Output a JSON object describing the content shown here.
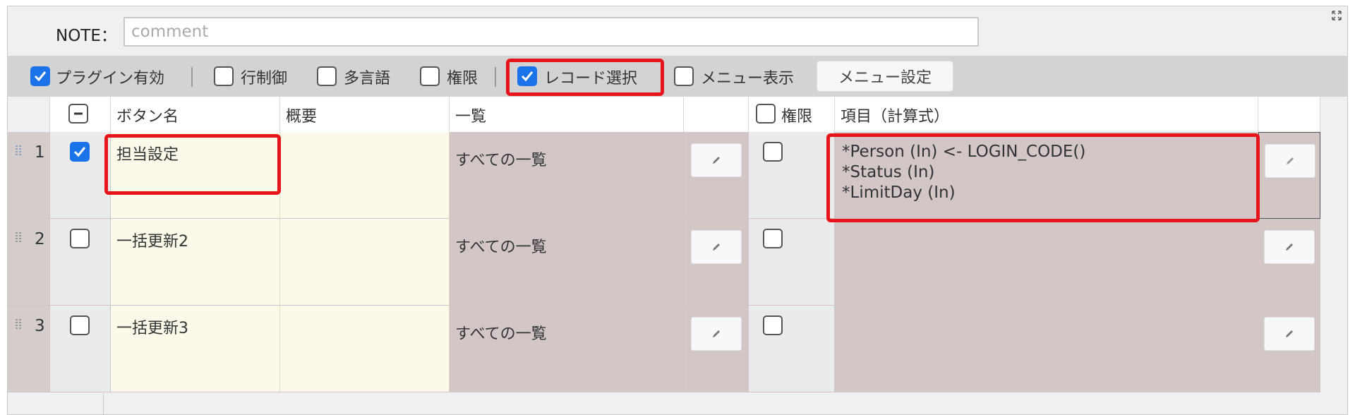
{
  "note": {
    "label": "NOTE：",
    "placeholder": "comment",
    "value": ""
  },
  "toolbar": {
    "options": [
      {
        "label": "プラグイン有効",
        "checked": true
      },
      {
        "label": "行制御",
        "checked": false
      },
      {
        "label": "多言語",
        "checked": false
      },
      {
        "label": "権限",
        "checked": false
      },
      {
        "label": "レコード選択",
        "checked": true
      },
      {
        "label": "メニュー表示",
        "checked": false
      }
    ],
    "menu_button": "メニュー設定"
  },
  "grid": {
    "headers": {
      "button_name": "ボタン名",
      "summary": "概要",
      "list": "一覧",
      "auth": "権限",
      "items": "項目（計算式）"
    },
    "rows": [
      {
        "num": "1",
        "checked": true,
        "name": "担当設定",
        "summary": "",
        "list": "すべての一覧",
        "auth": false,
        "items": [
          "*Person (In) <- LOGIN_CODE()",
          "*Status (In)",
          "*LimitDay (In)"
        ]
      },
      {
        "num": "2",
        "checked": false,
        "name": "一括更新2",
        "summary": "",
        "list": "すべての一覧",
        "auth": false,
        "items": []
      },
      {
        "num": "3",
        "checked": false,
        "name": "一括更新3",
        "summary": "",
        "list": "すべての一覧",
        "auth": false,
        "items": []
      }
    ]
  },
  "colors": {
    "highlight": "#e8141b",
    "checkbox_checked": "#1a73e8"
  },
  "icons": {
    "expand": "expand-icon",
    "pencil": "pencil-icon",
    "drag": "drag-handle-icon",
    "check": "check-icon",
    "minus": "minus-icon"
  }
}
